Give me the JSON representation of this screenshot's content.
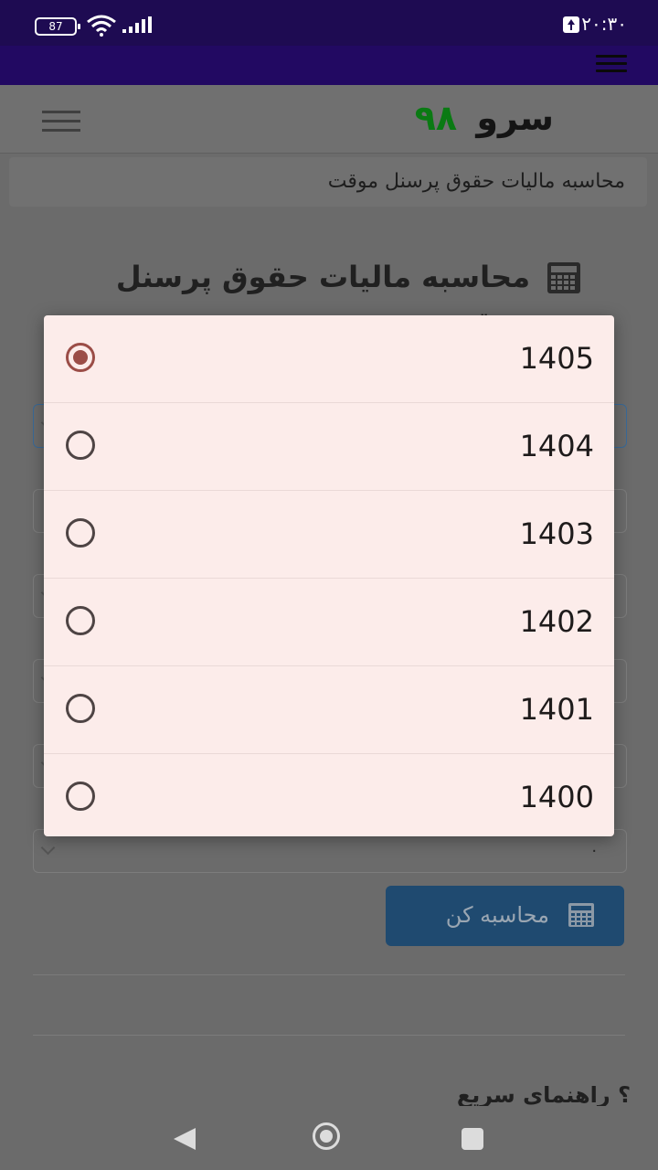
{
  "status_bar": {
    "time": "۲۰:۳۰",
    "battery": "87"
  },
  "header": {
    "brand": "سرو",
    "brand_number": "۹۸"
  },
  "breadcrumb": "محاسبه مالیات حقوق پرسنل موقت",
  "page_title": "محاسبه مالیات حقوق پرسنل موقت",
  "form": {
    "last_field_value": "۰"
  },
  "calc_button_label": "محاسبه کن",
  "guide_heading": "؟ راهنمای سریع",
  "year_dialog": {
    "selected": "1405",
    "options": [
      "1405",
      "1404",
      "1403",
      "1402",
      "1401",
      "1400"
    ]
  },
  "colors": {
    "status_bar": "#1e0b52",
    "app_bar": "#220962",
    "dialog": "#fcecea",
    "radio_checked": "#9b4d47",
    "brand_number": "#0a7a13"
  }
}
